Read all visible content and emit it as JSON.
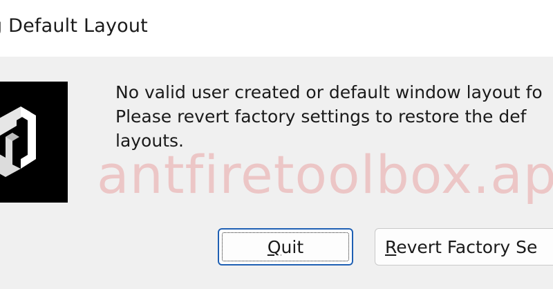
{
  "dialog": {
    "title": "g Default Layout",
    "message_lines": [
      "No valid user created or default window layout fo",
      "Please revert factory settings to restore the def",
      "layouts."
    ],
    "logo_icon": "unity-cube-icon",
    "watermark": "antfiretoolbox.app"
  },
  "buttons": {
    "quit": {
      "mnemonic": "Q",
      "rest": "uit"
    },
    "revert": {
      "mnemonic": "R",
      "rest": "evert Factory Se"
    }
  },
  "colors": {
    "focus_border": "#1e5fb3",
    "logo_bg": "#000000",
    "watermark": "#e67878"
  }
}
